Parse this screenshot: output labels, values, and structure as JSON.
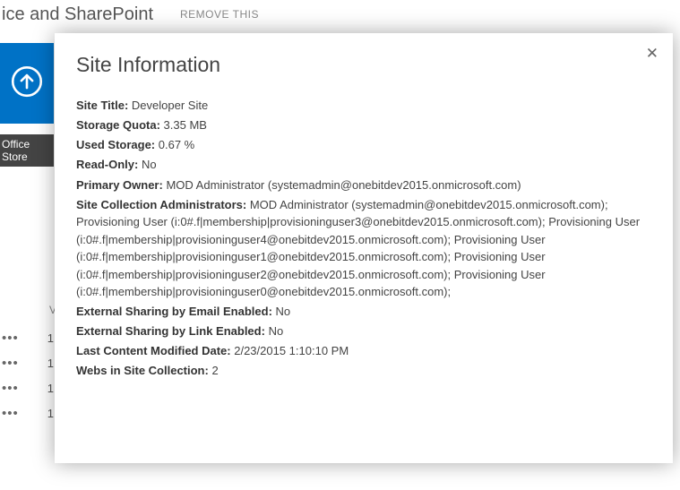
{
  "background": {
    "header_title": "ice and SharePoint",
    "header_action": "REMOVE THIS",
    "gray_label": "Office Store",
    "table_header": "V",
    "rows": [
      "1",
      "1",
      "1",
      "1"
    ]
  },
  "modal": {
    "title": "Site Information",
    "fields": {
      "site_title_label": "Site Title:",
      "site_title_value": "Developer Site",
      "storage_quota_label": "Storage Quota:",
      "storage_quota_value": "3.35 MB",
      "used_storage_label": "Used Storage:",
      "used_storage_value": "0.67 %",
      "read_only_label": "Read-Only:",
      "read_only_value": "No",
      "primary_owner_label": "Primary Owner:",
      "primary_owner_value": "MOD Administrator (systemadmin@onebitdev2015.onmicrosoft.com)",
      "sca_label": "Site Collection Administrators:",
      "sca_value": "MOD Administrator (systemadmin@onebitdev2015.onmicrosoft.com); Provisioning User (i:0#.f|membership|provisioninguser3@onebitdev2015.onmicrosoft.com); Provisioning User (i:0#.f|membership|provisioninguser4@onebitdev2015.onmicrosoft.com); Provisioning User (i:0#.f|membership|provisioninguser1@onebitdev2015.onmicrosoft.com); Provisioning User (i:0#.f|membership|provisioninguser2@onebitdev2015.onmicrosoft.com); Provisioning User (i:0#.f|membership|provisioninguser0@onebitdev2015.onmicrosoft.com);",
      "ext_email_label": "External Sharing by Email Enabled:",
      "ext_email_value": "No",
      "ext_link_label": "External Sharing by Link Enabled:",
      "ext_link_value": "No",
      "last_modified_label": "Last Content Modified Date:",
      "last_modified_value": "2/23/2015 1:10:10 PM",
      "webs_label": "Webs in Site Collection:",
      "webs_value": "2"
    }
  }
}
